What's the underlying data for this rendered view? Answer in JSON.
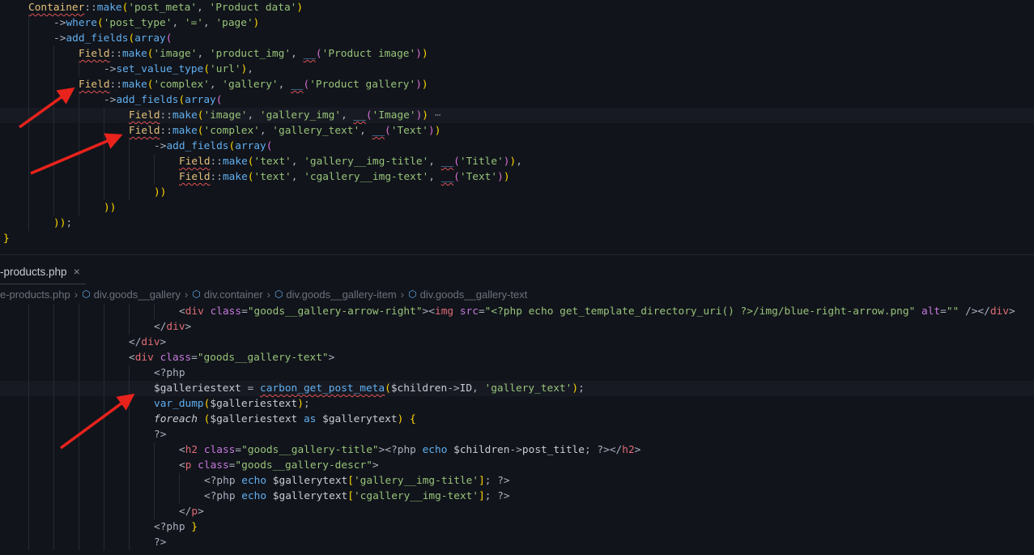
{
  "top_editor": {
    "lines": [
      {
        "indent": 1,
        "text": "Container::make('post_meta', 'Product data')"
      },
      {
        "indent": 2,
        "text": "->where('post_type', '=', 'page')"
      },
      {
        "indent": 2,
        "text": "->add_fields(array("
      },
      {
        "indent": 3,
        "text": "Field::make('image', 'product_img', __('Product image'))"
      },
      {
        "indent": 4,
        "text": "->set_value_type('url'),"
      },
      {
        "indent": 3,
        "text": "Field::make('complex', 'gallery', __('Product gallery'))"
      },
      {
        "indent": 4,
        "text": "->add_fields(array("
      },
      {
        "indent": 5,
        "text": "Field::make('image', 'gallery_img', __('Image'))",
        "folded": "⋯",
        "highlight": true
      },
      {
        "indent": 5,
        "text": "Field::make('complex', 'gallery_text', __('Text'))"
      },
      {
        "indent": 6,
        "text": "->add_fields(array("
      },
      {
        "indent": 7,
        "text": "Field::make('text', 'gallery__img-title', __('Title')),"
      },
      {
        "indent": 7,
        "text": "Field::make('text', 'cgallery__img-text', __('Text'))"
      },
      {
        "indent": 6,
        "text": "))"
      },
      {
        "indent": 4,
        "text": "))"
      },
      {
        "indent": 2,
        "text": "));"
      },
      {
        "indent": 0,
        "text": "}"
      }
    ]
  },
  "bottom_editor": {
    "tab": {
      "label": "-products.php",
      "close": "×"
    },
    "breadcrumb": [
      "e-products.php",
      "div.goods__gallery",
      "div.container",
      "div.goods__gallery-item",
      "div.goods__gallery-text"
    ],
    "lines": [
      {
        "indent": 7,
        "text": "<div class=\"goods__gallery-arrow-right\"><img src=\"<?php echo get_template_directory_uri() ?>/img/blue-right-arrow.png\" alt=\"\" /></div>"
      },
      {
        "indent": 6,
        "text": "</div>"
      },
      {
        "indent": 5,
        "text": "</div>"
      },
      {
        "indent": 5,
        "text": "<div class=\"goods__gallery-text\">"
      },
      {
        "indent": 6,
        "text": "<?php"
      },
      {
        "indent": 6,
        "text": "$galleriestext = carbon_get_post_meta($children->ID, 'gallery_text');",
        "highlight": true
      },
      {
        "indent": 6,
        "text": "var_dump($galleriestext);"
      },
      {
        "indent": 6,
        "text": "foreach ($galleriestext as $gallerytext) {"
      },
      {
        "indent": 6,
        "text": "?>"
      },
      {
        "indent": 7,
        "text": "<h2 class=\"goods__gallery-title\"><?php echo $children->post_title; ?></h2>"
      },
      {
        "indent": 7,
        "text": "<p class=\"goods__gallery-descr\">"
      },
      {
        "indent": 8,
        "text": "<?php echo $gallerytext['gallery__img-title']; ?>"
      },
      {
        "indent": 8,
        "text": "<?php echo $gallerytext['cgallery__img-text']; ?>"
      },
      {
        "indent": 7,
        "text": "</p>"
      },
      {
        "indent": 6,
        "text": "<?php }"
      },
      {
        "indent": 6,
        "text": "?>"
      }
    ]
  },
  "colors": {
    "background": "#11141b",
    "annotation_arrow": "#e8231c"
  }
}
